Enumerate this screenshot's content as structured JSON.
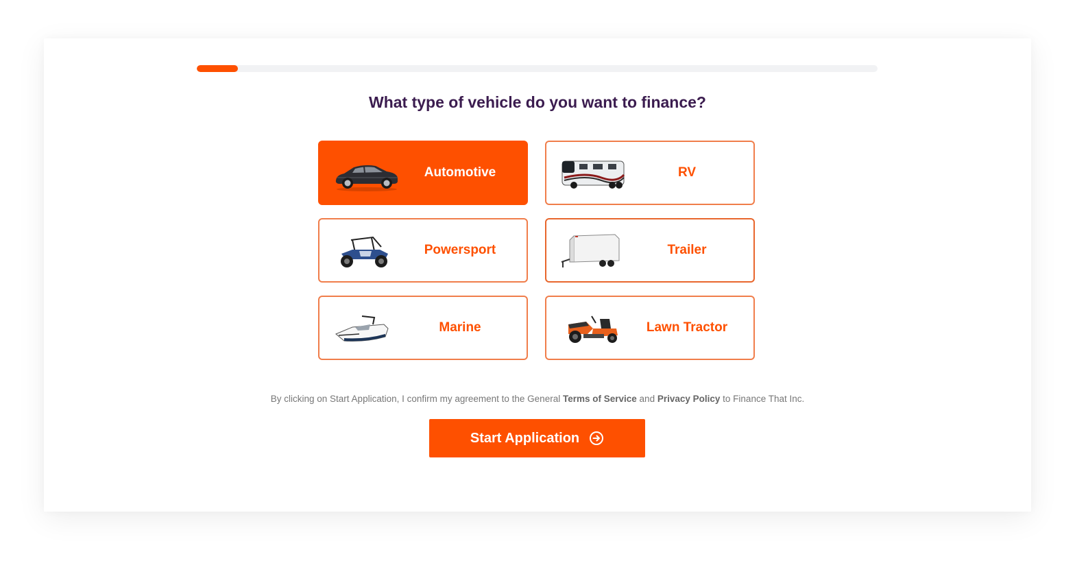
{
  "progress": {
    "value_percent": 6
  },
  "question": "What type of vehicle do you want to finance?",
  "options": [
    {
      "label": "Automotive",
      "icon": "car-icon",
      "selected": true
    },
    {
      "label": "RV",
      "icon": "rv-motorhome-icon",
      "selected": false
    },
    {
      "label": "Powersport",
      "icon": "utv-side-by-side-icon",
      "selected": false
    },
    {
      "label": "Trailer",
      "icon": "cargo-trailer-icon",
      "selected": false
    },
    {
      "label": "Marine",
      "icon": "boat-icon",
      "selected": false
    },
    {
      "label": "Lawn Tractor",
      "icon": "lawn-tractor-icon",
      "selected": false
    }
  ],
  "consent": {
    "prefix": "By clicking on Start Application, I confirm my agreement to the General",
    "terms": "Terms of Service",
    "and": "and",
    "privacy": "Privacy Policy",
    "suffix": "to Finance That Inc."
  },
  "start_button": {
    "label": "Start Application",
    "icon": "arrow-circle-right-icon"
  },
  "colors": {
    "accent": "#fe5000",
    "heading": "#3b1c4f",
    "muted": "#777777",
    "track": "#f1f2f4"
  }
}
